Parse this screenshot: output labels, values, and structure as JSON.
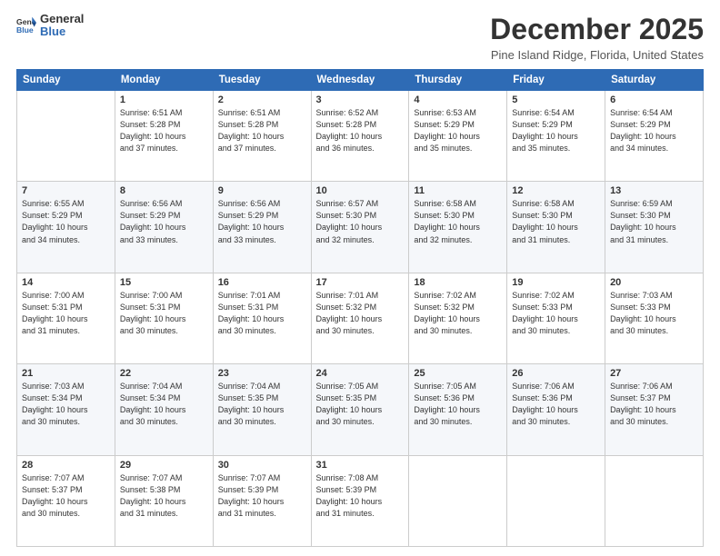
{
  "header": {
    "logo_general": "General",
    "logo_blue": "Blue",
    "title": "December 2025",
    "subtitle": "Pine Island Ridge, Florida, United States"
  },
  "columns": [
    "Sunday",
    "Monday",
    "Tuesday",
    "Wednesday",
    "Thursday",
    "Friday",
    "Saturday"
  ],
  "weeks": [
    [
      {
        "day": "",
        "info": ""
      },
      {
        "day": "1",
        "info": "Sunrise: 6:51 AM\nSunset: 5:28 PM\nDaylight: 10 hours\nand 37 minutes."
      },
      {
        "day": "2",
        "info": "Sunrise: 6:51 AM\nSunset: 5:28 PM\nDaylight: 10 hours\nand 37 minutes."
      },
      {
        "day": "3",
        "info": "Sunrise: 6:52 AM\nSunset: 5:28 PM\nDaylight: 10 hours\nand 36 minutes."
      },
      {
        "day": "4",
        "info": "Sunrise: 6:53 AM\nSunset: 5:29 PM\nDaylight: 10 hours\nand 35 minutes."
      },
      {
        "day": "5",
        "info": "Sunrise: 6:54 AM\nSunset: 5:29 PM\nDaylight: 10 hours\nand 35 minutes."
      },
      {
        "day": "6",
        "info": "Sunrise: 6:54 AM\nSunset: 5:29 PM\nDaylight: 10 hours\nand 34 minutes."
      }
    ],
    [
      {
        "day": "7",
        "info": "Sunrise: 6:55 AM\nSunset: 5:29 PM\nDaylight: 10 hours\nand 34 minutes."
      },
      {
        "day": "8",
        "info": "Sunrise: 6:56 AM\nSunset: 5:29 PM\nDaylight: 10 hours\nand 33 minutes."
      },
      {
        "day": "9",
        "info": "Sunrise: 6:56 AM\nSunset: 5:29 PM\nDaylight: 10 hours\nand 33 minutes."
      },
      {
        "day": "10",
        "info": "Sunrise: 6:57 AM\nSunset: 5:30 PM\nDaylight: 10 hours\nand 32 minutes."
      },
      {
        "day": "11",
        "info": "Sunrise: 6:58 AM\nSunset: 5:30 PM\nDaylight: 10 hours\nand 32 minutes."
      },
      {
        "day": "12",
        "info": "Sunrise: 6:58 AM\nSunset: 5:30 PM\nDaylight: 10 hours\nand 31 minutes."
      },
      {
        "day": "13",
        "info": "Sunrise: 6:59 AM\nSunset: 5:30 PM\nDaylight: 10 hours\nand 31 minutes."
      }
    ],
    [
      {
        "day": "14",
        "info": "Sunrise: 7:00 AM\nSunset: 5:31 PM\nDaylight: 10 hours\nand 31 minutes."
      },
      {
        "day": "15",
        "info": "Sunrise: 7:00 AM\nSunset: 5:31 PM\nDaylight: 10 hours\nand 30 minutes."
      },
      {
        "day": "16",
        "info": "Sunrise: 7:01 AM\nSunset: 5:31 PM\nDaylight: 10 hours\nand 30 minutes."
      },
      {
        "day": "17",
        "info": "Sunrise: 7:01 AM\nSunset: 5:32 PM\nDaylight: 10 hours\nand 30 minutes."
      },
      {
        "day": "18",
        "info": "Sunrise: 7:02 AM\nSunset: 5:32 PM\nDaylight: 10 hours\nand 30 minutes."
      },
      {
        "day": "19",
        "info": "Sunrise: 7:02 AM\nSunset: 5:33 PM\nDaylight: 10 hours\nand 30 minutes."
      },
      {
        "day": "20",
        "info": "Sunrise: 7:03 AM\nSunset: 5:33 PM\nDaylight: 10 hours\nand 30 minutes."
      }
    ],
    [
      {
        "day": "21",
        "info": "Sunrise: 7:03 AM\nSunset: 5:34 PM\nDaylight: 10 hours\nand 30 minutes."
      },
      {
        "day": "22",
        "info": "Sunrise: 7:04 AM\nSunset: 5:34 PM\nDaylight: 10 hours\nand 30 minutes."
      },
      {
        "day": "23",
        "info": "Sunrise: 7:04 AM\nSunset: 5:35 PM\nDaylight: 10 hours\nand 30 minutes."
      },
      {
        "day": "24",
        "info": "Sunrise: 7:05 AM\nSunset: 5:35 PM\nDaylight: 10 hours\nand 30 minutes."
      },
      {
        "day": "25",
        "info": "Sunrise: 7:05 AM\nSunset: 5:36 PM\nDaylight: 10 hours\nand 30 minutes."
      },
      {
        "day": "26",
        "info": "Sunrise: 7:06 AM\nSunset: 5:36 PM\nDaylight: 10 hours\nand 30 minutes."
      },
      {
        "day": "27",
        "info": "Sunrise: 7:06 AM\nSunset: 5:37 PM\nDaylight: 10 hours\nand 30 minutes."
      }
    ],
    [
      {
        "day": "28",
        "info": "Sunrise: 7:07 AM\nSunset: 5:37 PM\nDaylight: 10 hours\nand 30 minutes."
      },
      {
        "day": "29",
        "info": "Sunrise: 7:07 AM\nSunset: 5:38 PM\nDaylight: 10 hours\nand 31 minutes."
      },
      {
        "day": "30",
        "info": "Sunrise: 7:07 AM\nSunset: 5:39 PM\nDaylight: 10 hours\nand 31 minutes."
      },
      {
        "day": "31",
        "info": "Sunrise: 7:08 AM\nSunset: 5:39 PM\nDaylight: 10 hours\nand 31 minutes."
      },
      {
        "day": "",
        "info": ""
      },
      {
        "day": "",
        "info": ""
      },
      {
        "day": "",
        "info": ""
      }
    ]
  ]
}
